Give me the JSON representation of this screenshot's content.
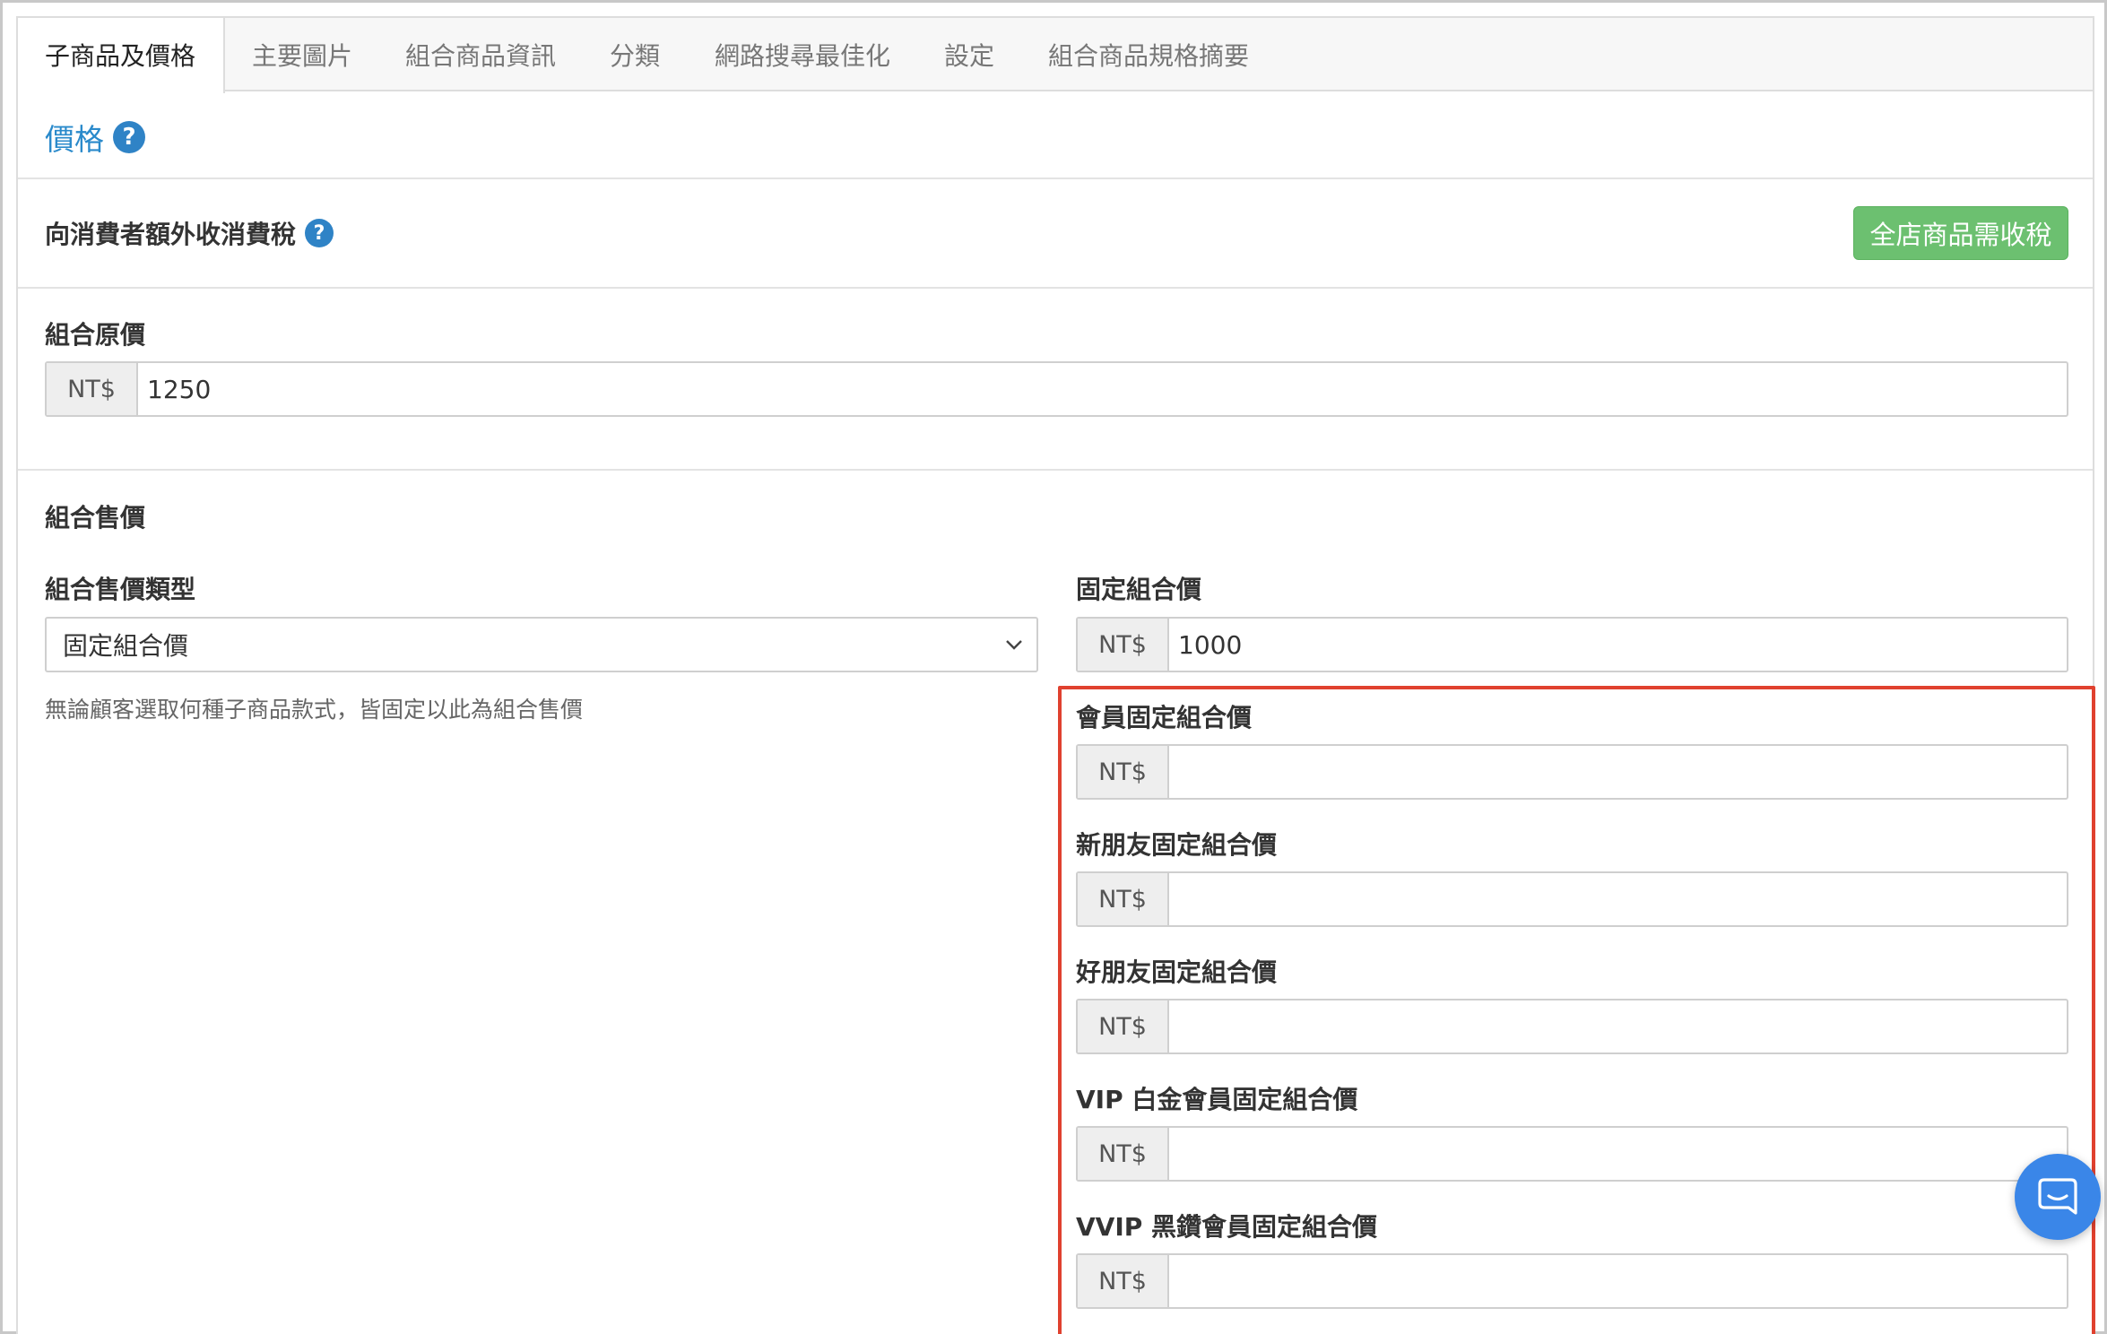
{
  "tabs": [
    {
      "label": "子商品及價格",
      "active": true
    },
    {
      "label": "主要圖片"
    },
    {
      "label": "組合商品資訊"
    },
    {
      "label": "分類"
    },
    {
      "label": "網路搜尋最佳化"
    },
    {
      "label": "設定"
    },
    {
      "label": "組合商品規格摘要"
    }
  ],
  "price_section": {
    "title": "價格",
    "help_icon": "question-circle-icon"
  },
  "tax": {
    "label": "向消費者額外收消費稅",
    "button_label": "全店商品需收稅",
    "button_color": "#6cc070"
  },
  "original_price": {
    "label": "組合原價",
    "currency": "NT$",
    "value": "1250"
  },
  "bundle_price": {
    "heading": "組合售價",
    "type_label": "組合售價類型",
    "type_selected": "固定組合價",
    "type_hint": "無論顧客選取何種子商品款式，皆固定以此為組合售價",
    "fixed_label": "固定組合價",
    "fixed_currency": "NT$",
    "fixed_value": "1000"
  },
  "member_prices": [
    {
      "label": "會員固定組合價",
      "currency": "NT$",
      "value": ""
    },
    {
      "label": "新朋友固定組合價",
      "currency": "NT$",
      "value": ""
    },
    {
      "label": "好朋友固定組合價",
      "currency": "NT$",
      "value": ""
    },
    {
      "label": "VIP 白金會員固定組合價",
      "currency": "NT$",
      "value": ""
    },
    {
      "label": "VVIP 黑鑽會員固定組合價",
      "currency": "NT$",
      "value": ""
    }
  ],
  "highlight_color": "#e0412f",
  "chat_widget": {
    "icon": "chat-bubble-icon",
    "color": "#3a86e8"
  }
}
